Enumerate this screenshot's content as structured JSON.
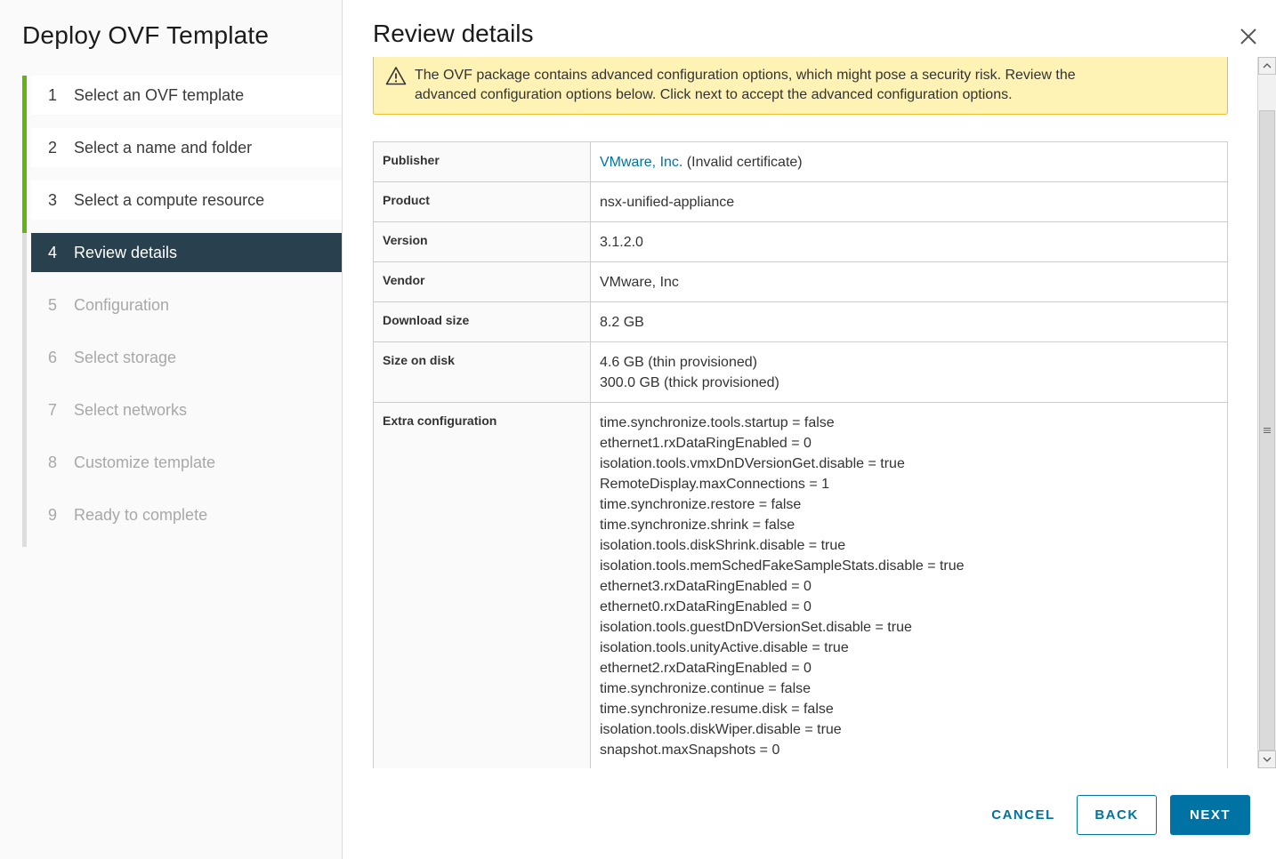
{
  "wizard": {
    "title": "Deploy OVF Template",
    "steps": [
      {
        "num": "1",
        "label": "Select an OVF template",
        "state": "done"
      },
      {
        "num": "2",
        "label": "Select a name and folder",
        "state": "done"
      },
      {
        "num": "3",
        "label": "Select a compute resource",
        "state": "done"
      },
      {
        "num": "4",
        "label": "Review details",
        "state": "active"
      },
      {
        "num": "5",
        "label": "Configuration",
        "state": "todo"
      },
      {
        "num": "6",
        "label": "Select storage",
        "state": "todo"
      },
      {
        "num": "7",
        "label": "Select networks",
        "state": "todo"
      },
      {
        "num": "8",
        "label": "Customize template",
        "state": "todo"
      },
      {
        "num": "9",
        "label": "Ready to complete",
        "state": "todo"
      }
    ]
  },
  "page": {
    "title": "Review details",
    "close_icon": "close-icon"
  },
  "alert": {
    "icon": "warning-icon",
    "line1": "The OVF package contains advanced configuration options, which might pose a security risk. Review the",
    "line2": "advanced configuration options below. Click next to accept the advanced configuration options."
  },
  "details": {
    "publisher": {
      "label": "Publisher",
      "link": "VMware, Inc.",
      "note": " (Invalid certificate)"
    },
    "product": {
      "label": "Product",
      "value": "nsx-unified-appliance"
    },
    "version": {
      "label": "Version",
      "value": "3.1.2.0"
    },
    "vendor": {
      "label": "Vendor",
      "value": "VMware, Inc"
    },
    "download_size": {
      "label": "Download size",
      "value": "8.2 GB"
    },
    "size_on_disk": {
      "label": "Size on disk",
      "thin": "4.6 GB (thin provisioned)",
      "thick": "300.0 GB (thick provisioned)"
    },
    "extra_configuration": {
      "label": "Extra configuration",
      "lines": [
        "time.synchronize.tools.startup = false",
        "ethernet1.rxDataRingEnabled = 0",
        "isolation.tools.vmxDnDVersionGet.disable = true",
        "RemoteDisplay.maxConnections = 1",
        "time.synchronize.restore = false",
        "time.synchronize.shrink = false",
        "isolation.tools.diskShrink.disable = true",
        "isolation.tools.memSchedFakeSampleStats.disable = true",
        "ethernet3.rxDataRingEnabled = 0",
        "ethernet0.rxDataRingEnabled = 0",
        "isolation.tools.guestDnDVersionSet.disable = true",
        "isolation.tools.unityActive.disable = true",
        "ethernet2.rxDataRingEnabled = 0",
        "time.synchronize.continue = false",
        "time.synchronize.resume.disk = false",
        "isolation.tools.diskWiper.disable = true",
        "snapshot.maxSnapshots = 0"
      ]
    }
  },
  "footer": {
    "cancel_label": "CANCEL",
    "back_label": "BACK",
    "next_label": "NEXT"
  },
  "colors": {
    "active_step_bg": "#29414e",
    "done_rail": "#60b515",
    "primary": "#0072a3",
    "alert_bg": "#fef3b5",
    "alert_border": "#ebc22e"
  }
}
